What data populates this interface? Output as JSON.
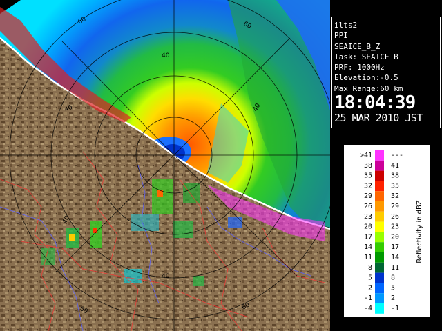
{
  "info": {
    "station": "ilts2",
    "scan_type": "PPI",
    "product": "SEAICE_B_Z",
    "task": "Task: SEAICE_B",
    "prf": "PRF: 1000Hz",
    "elevation": "Elevation:-0.5",
    "max_range": "Max Range:60 km",
    "time": "18:04:39",
    "date": "25 MAR 2010 JST"
  },
  "range_ring_labels": {
    "top_60": "60",
    "top_right_60": "60",
    "upper_40": "40",
    "left_40": "40",
    "right_40": "40",
    "lower_left_40": "40",
    "bottom_40": "40",
    "bottom_left_60": "60",
    "bottom_right_60": "60"
  },
  "legend": {
    "unit_label": "Reflectivity in dBZ",
    "bins": [
      {
        "low": ">41",
        "high": "---",
        "color": "#ff33ff"
      },
      {
        "low": "38",
        "high": "41",
        "color": "#cc0099"
      },
      {
        "low": "35",
        "high": "38",
        "color": "#cc0000"
      },
      {
        "low": "32",
        "high": "35",
        "color": "#ff2200"
      },
      {
        "low": "29",
        "high": "32",
        "color": "#ff6600"
      },
      {
        "low": "26",
        "high": "29",
        "color": "#ff9900"
      },
      {
        "low": "23",
        "high": "26",
        "color": "#ffcc00"
      },
      {
        "low": "20",
        "high": "23",
        "color": "#ffff00"
      },
      {
        "low": "17",
        "high": "20",
        "color": "#99ff00"
      },
      {
        "low": "14",
        "high": "17",
        "color": "#33cc00"
      },
      {
        "low": "11",
        "high": "14",
        "color": "#009900"
      },
      {
        "low": "8",
        "high": "11",
        "color": "#006633"
      },
      {
        "low": "5",
        "high": "8",
        "color": "#0033cc"
      },
      {
        "low": "2",
        "high": "5",
        "color": "#0066ff"
      },
      {
        "low": "-1",
        "high": "2",
        "color": "#0099ff"
      },
      {
        "low": "-4",
        "high": "-1",
        "color": "#00ffff"
      }
    ]
  }
}
